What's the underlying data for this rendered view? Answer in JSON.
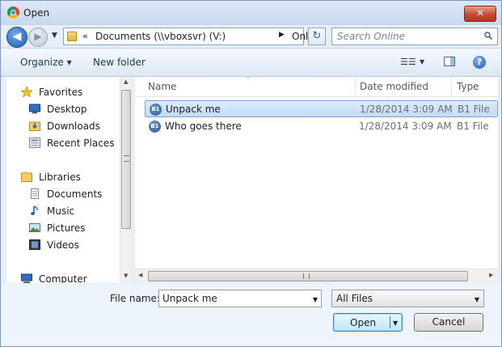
{
  "window": {
    "title": "Open",
    "close_label": "✕"
  },
  "navigation": {
    "back_label": "◀",
    "forward_label": "▶",
    "history_label": "▼",
    "address_chevron": "«",
    "address_segments": [
      "Documents (\\\\vboxsvr) (V:)",
      "Online"
    ],
    "address_sep": "▶",
    "address_dropdown": "▼",
    "refresh_label": "↻",
    "search_placeholder": "Search Online"
  },
  "commandbar": {
    "organize_label": "Organize ▾",
    "new_folder_label": "New folder",
    "views_label": "☰☰",
    "views_arrow": "▼",
    "help_label": "?"
  },
  "sidebar": {
    "favorites": {
      "label": "Favorites",
      "items": [
        "Desktop",
        "Downloads",
        "Recent Places"
      ]
    },
    "libraries": {
      "label": "Libraries",
      "items": [
        "Documents",
        "Music",
        "Pictures",
        "Videos"
      ]
    },
    "computer": {
      "label": "Computer"
    },
    "scroll_up": "▲",
    "scroll_down": "▼"
  },
  "file_list": {
    "columns": {
      "name": "Name",
      "date": "Date modified",
      "type": "Type"
    },
    "sort_indicator": "^",
    "rows": [
      {
        "icon": "B1",
        "name": "Unpack me",
        "date": "1/28/2014 3:09 AM",
        "type": "B1 File",
        "selected": true
      },
      {
        "icon": "B1",
        "name": "Who goes there",
        "date": "1/28/2014 3:09 AM",
        "type": "B1 File",
        "selected": false
      }
    ],
    "scroll_left": "◀",
    "scroll_right": "▶"
  },
  "footer": {
    "filename_label": "File name:",
    "filename_value": "Unpack me",
    "filename_arrow": "▼",
    "filetype_value": "All Files",
    "filetype_arrow": "▼",
    "open_label": "Open",
    "open_arrow": "▼",
    "cancel_label": "Cancel"
  },
  "colors": {
    "accent": "#3c7fb1",
    "selection": "#c1dcfc",
    "window_bg": "#e6eef8"
  }
}
